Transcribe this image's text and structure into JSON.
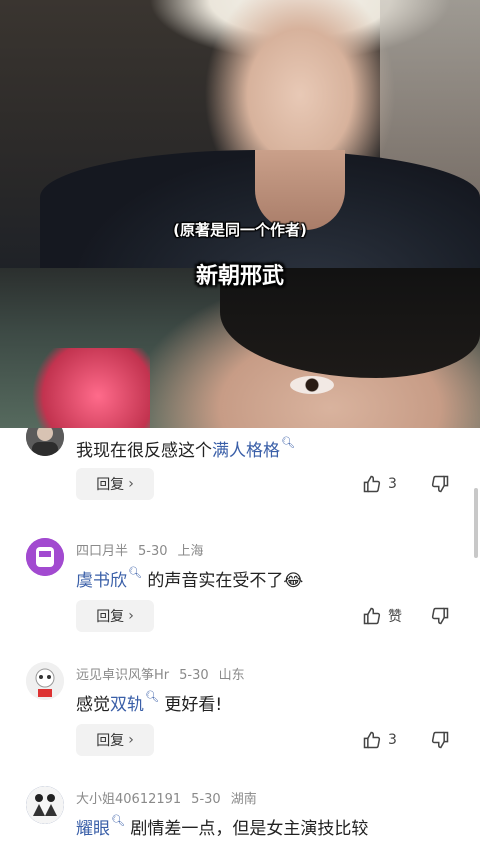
{
  "video": {
    "subtitle": "(原著是同一个作者)",
    "caption": "新朝邢武"
  },
  "comments": [
    {
      "user": "",
      "date": "",
      "location": "",
      "text_before": "我现在很反感这个",
      "link": "满人格格",
      "text_after": "",
      "reply_label": "回复",
      "likes": "3"
    },
    {
      "user": "四口月半",
      "date": "5-30",
      "location": "上海",
      "text_before": "",
      "link": "虞书欣",
      "text_after": " 的声音实在受不了",
      "emoji": "😂",
      "reply_label": "回复",
      "likes": "赞"
    },
    {
      "user": "远见卓识风筝Hr",
      "date": "5-30",
      "location": "山东",
      "text_before": "感觉",
      "link": "双轨",
      "text_after": " 更好看!",
      "reply_label": "回复",
      "likes": "3"
    },
    {
      "user": "大小姐40612191",
      "date": "5-30",
      "location": "湖南",
      "text_before": "",
      "link": "耀眼",
      "text_after": " 剧情差一点，但是女主演技比较",
      "reply_label": "",
      "likes": ""
    }
  ],
  "icons": {
    "search_marker": "search-icon",
    "like": "thumbs-up-icon",
    "dislike": "thumbs-down-icon",
    "reply_chevron": "chevron-right-icon"
  },
  "colors": {
    "link": "#3a5fa8",
    "meta": "#8a8a8a"
  }
}
